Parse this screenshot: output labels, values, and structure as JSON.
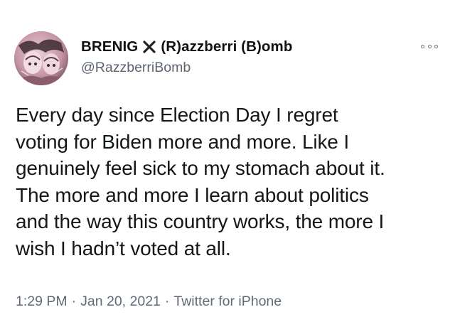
{
  "author": {
    "name_part1": "BRENIG",
    "name_part2": "(R)azzberri (B)omb",
    "handle": "@RazzberriBomb",
    "avatar_icon": "profile-avatar-artwork",
    "name_separator_icon": "x-cross-icon"
  },
  "header": {
    "more_icon": "more-options-icon"
  },
  "tweet": {
    "lines": [
      "Every day since Election Day I regret",
      "voting for Biden more and more. Like I",
      "genuinely feel sick to my stomach about it.",
      "The more and more I learn about politics",
      "and the way this country works, the more I",
      "wish I hadn’t voted at all."
    ]
  },
  "meta": {
    "time": "1:29 PM",
    "date": "Jan 20, 2021",
    "source": "Twitter for iPhone",
    "separator": "·"
  },
  "colors": {
    "text": "#14171a",
    "secondary": "#5f6a74",
    "background": "#ffffff"
  }
}
